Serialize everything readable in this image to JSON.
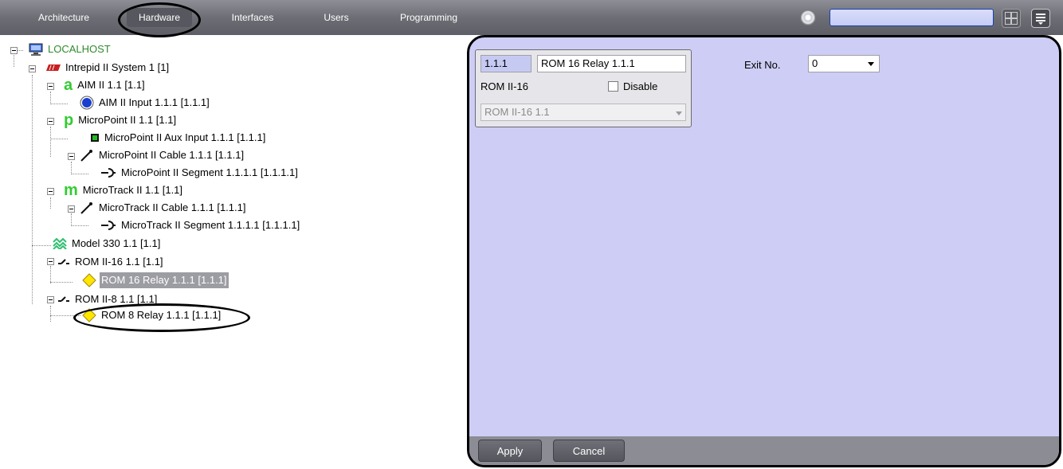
{
  "tabs": {
    "architecture": "Architecture",
    "hardware": "Hardware",
    "interfaces": "Interfaces",
    "users": "Users",
    "programming": "Programming"
  },
  "tree": {
    "root": "LOCALHOST",
    "system": "Intrepid II System 1 [1]",
    "aim": "AIM II 1.1 [1.1]",
    "aim_input": "AIM II Input 1.1.1 [1.1.1]",
    "micropoint": "MicroPoint II 1.1 [1.1]",
    "micropoint_aux": "MicroPoint II Aux Input 1.1.1 [1.1.1]",
    "micropoint_cable": "MicroPoint II Cable 1.1.1 [1.1.1]",
    "micropoint_segment": "MicroPoint II Segment 1.1.1.1 [1.1.1.1]",
    "microtrack": "MicroTrack II 1.1 [1.1]",
    "microtrack_cable": "MicroTrack II Cable 1.1.1 [1.1.1]",
    "microtrack_segment": "MicroTrack II Segment 1.1.1.1 [1.1.1.1]",
    "model330": "Model 330 1.1 [1.1]",
    "rom16": "ROM II-16 1.1 [1.1]",
    "rom16_relay": "ROM 16 Relay 1.1.1 [1.1.1]",
    "rom8": "ROM II-8 1.1 [1.1]",
    "rom8_relay": "ROM 8 Relay 1.1.1 [1.1.1]"
  },
  "panel": {
    "id_value": "1.1.1",
    "name_value": "ROM 16 Relay 1.1.1",
    "parent_type": "ROM II-16",
    "disable_label": "Disable",
    "parent_select": "ROM II-16 1.1",
    "exit_label": "Exit No.",
    "exit_value": "0",
    "apply_label": "Apply",
    "cancel_label": "Cancel"
  },
  "icons": {
    "aim": "letter-a-icon",
    "micropoint": "letter-p-icon",
    "microtrack": "letter-m-icon"
  },
  "colors": {
    "panel_bg": "#cdcdf5",
    "selection": "#9c9ca3",
    "tree_root": "#2e8b2e",
    "letter_icon_green": "#33cc33"
  }
}
